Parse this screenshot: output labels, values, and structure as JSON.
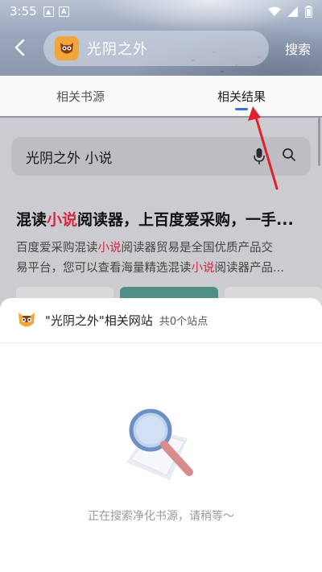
{
  "status_bar": {
    "time": "3:55",
    "notif_icons": [
      "image-icon",
      "a-icon"
    ],
    "right_icons": [
      "wifi-icon",
      "signal-icon",
      "battery-icon"
    ]
  },
  "header": {
    "title": "光阴之外",
    "search_label": "搜索",
    "back_icon": "back-arrow-icon"
  },
  "tabs": [
    {
      "label": "相关书源",
      "active": false
    },
    {
      "label": "相关结果",
      "active": true
    }
  ],
  "search": {
    "query": "光阴之外 小说"
  },
  "result": {
    "title_parts": [
      "混读",
      "小说",
      "阅读器，上百度爱采购，一手..."
    ],
    "desc_line1_parts": [
      "百度爱采购混读",
      "小说",
      "阅读器贸易是全国优质产品交"
    ],
    "desc_line2_parts": [
      "易平台，您可以查看海量精选混读",
      "小说",
      "阅读器产品..."
    ]
  },
  "sheet": {
    "title": "\"光阴之外\"相关网站",
    "count": "共0个站点",
    "status": "正在搜索净化书源，请稍等～"
  },
  "colors": {
    "accent": "#3f6fd8",
    "highlight": "#d6253f",
    "logo": "#f0a638",
    "arrow": "#e0202a"
  }
}
